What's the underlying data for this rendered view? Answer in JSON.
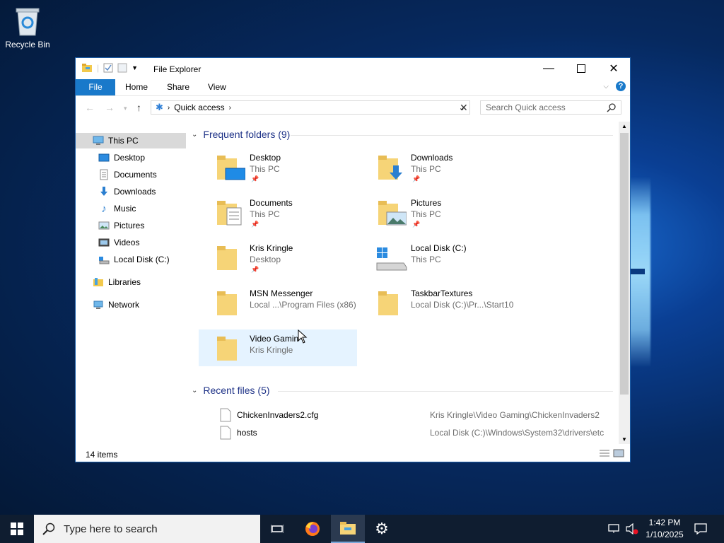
{
  "desktop": {
    "recycle_bin_label": "Recycle Bin"
  },
  "window": {
    "title": "File Explorer",
    "ribbon_tabs": [
      "File",
      "Home",
      "Share",
      "View"
    ],
    "address_location": "Quick access",
    "search_placeholder": "Search Quick access",
    "status": "14 items"
  },
  "navpane": {
    "items": [
      "This PC",
      "Desktop",
      "Documents",
      "Downloads",
      "Music",
      "Pictures",
      "Videos",
      "Local Disk (C:)",
      "Libraries",
      "Network"
    ]
  },
  "frequent": {
    "header": "Frequent folders (9)",
    "items": [
      {
        "name": "Desktop",
        "sub": "This PC"
      },
      {
        "name": "Downloads",
        "sub": "This PC"
      },
      {
        "name": "Documents",
        "sub": "This PC"
      },
      {
        "name": "Pictures",
        "sub": "This PC"
      },
      {
        "name": "Kris Kringle",
        "sub": "Desktop"
      },
      {
        "name": "Local Disk (C:)",
        "sub": "This PC"
      },
      {
        "name": "MSN Messenger",
        "sub": "Local ...\\Program Files (x86)"
      },
      {
        "name": "TaskbarTextures",
        "sub": "Local Disk (C:)\\Pr...\\Start10"
      },
      {
        "name": "Video Gamin",
        "sub": "Kris Kringle"
      }
    ]
  },
  "recent": {
    "header": "Recent files (5)",
    "items": [
      {
        "name": "ChickenInvaders2.cfg",
        "path": "Kris Kringle\\Video Gaming\\ChickenInvaders2"
      },
      {
        "name": "hosts",
        "path": "Local Disk (C:)\\Windows\\System32\\drivers\\etc"
      }
    ]
  },
  "taskbar": {
    "search_placeholder": "Type here to search",
    "time": "1:42 PM",
    "date": "1/10/2025"
  }
}
